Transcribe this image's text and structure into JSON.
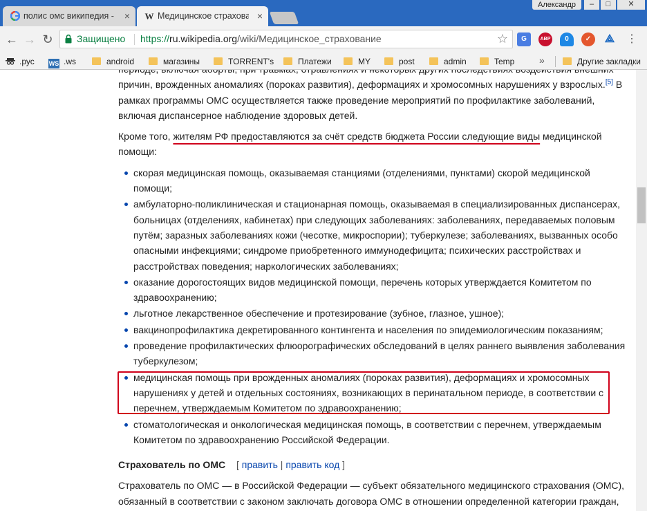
{
  "browser": {
    "tabs": [
      {
        "title": "полис омс википедия - По",
        "favicon": "google-icon",
        "active": false
      },
      {
        "title": "Медицинское страхование",
        "favicon": "wikipedia-icon",
        "active": true
      }
    ],
    "user": "Александр",
    "window_controls": {
      "minimize": "–",
      "maximize": "□",
      "close": "✕"
    },
    "nav": {
      "back": "←",
      "forward": "→",
      "reload": "↻"
    },
    "address": {
      "secure_label": "Защищено",
      "proto": "https://",
      "host": "ru.wikipedia.org",
      "path": "/wiki/Медицинское_страхование"
    },
    "extensions": [
      {
        "name": "translate-icon",
        "label": "G",
        "color": "#4a7de2"
      },
      {
        "name": "adblock-icon",
        "label": "ABP",
        "color": "#c8102e"
      },
      {
        "name": "ghostery-icon",
        "label": "0",
        "color": "#1e88e5"
      },
      {
        "name": "vpn-icon",
        "label": "✓",
        "color": "#e4572e"
      },
      {
        "name": "acrobat-icon",
        "label": "⟁",
        "color": "#1565c0"
      }
    ],
    "bookmarks": [
      {
        "label": ".рус",
        "icon": "spy-icon"
      },
      {
        "label": ".ws",
        "icon": "ws-icon"
      },
      {
        "label": "android",
        "icon": "folder-icon"
      },
      {
        "label": "магазины",
        "icon": "folder-icon"
      },
      {
        "label": "TORRENT's",
        "icon": "folder-icon"
      },
      {
        "label": "Платежи",
        "icon": "folder-icon"
      },
      {
        "label": "MY",
        "icon": "folder-icon"
      },
      {
        "label": "post",
        "icon": "folder-icon"
      },
      {
        "label": "admin",
        "icon": "folder-icon"
      },
      {
        "label": "Temp",
        "icon": "folder-icon"
      }
    ],
    "bookmarks_more": "»",
    "other_bookmarks": "Другие закладки"
  },
  "article": {
    "p1_text": "периоде, включая аборты; при травмах, отравлениях и некоторых других последствиях воздействия внешних причин, врожденных аномалиях (пороках развития), деформациях и хромосомных нарушениях у взрослых.",
    "p1_cite": "[5]",
    "p1_rest": " В рамках программы ОМС осуществляется также проведение мероприятий по профилактике заболеваний, включая диспансерное наблюдение здоровых детей.",
    "p2_start": "Кроме того, ",
    "p2_underlined": "жителям РФ предоставляются за счёт средств бюджета России следующие виды",
    "p2_end": " медицинской помощи:",
    "list": [
      "скорая медицинская помощь, оказываемая станциями (отделениями, пунктами) скорой медицинской помощи;",
      "амбулаторно-поликлиническая и стационарная помощь, оказываемая в специализированных диспансерах, больницах (отделениях, кабинетах) при следующих заболеваниях: заболеваниях, передаваемых половым путём; заразных заболеваниях кожи (чесотке, микроспории); туберкулезе; заболеваниях, вызванных особо опасными инфекциями; синдроме приобретенного иммунодефицита; психических расстройствах и расстройствах поведения; наркологических заболеваниях;",
      "оказание дорогостоящих видов медицинской помощи, перечень которых утверждается Комитетом по здравоохранению;",
      "льготное лекарственное обеспечение и протезирование (зубное, глазное, ушное);",
      "вакцинопрофилактика декретированного контингента и населения по эпидемиологическим показаниям;",
      "проведение профилактических флюорографических обследований в целях раннего выявления заболевания туберкулезом;",
      "медицинская помощь при врожденных аномалиях (пороках развития), деформациях и хромосомных нарушениях у детей и отдельных состояниях, возникающих в перинатальном периоде, в соответствии с перечнем, утверждаемым Комитетом по здравоохранению;",
      "стоматологическая и онкологическая медицинская помощь, в соответствии с перечнем, утверждаемым Комитетом по здравоохранению Российской Федерации."
    ],
    "section_heading": "Страхователь по ОМС",
    "edit_open": "[",
    "edit_link": "править",
    "edit_sep": "|",
    "edit_code_link": "править код",
    "edit_close": "]",
    "p3": "Страхователь по ОМС — в Российской Федерации — субъект обязательного медицинского страхования (ОМС), обязанный в соответствии с законом заключать договора ОМС в отношении определенной категории граждан, наделенный с этой целью определенными правами и обременный определенными обязанностями."
  },
  "annotation_colors": {
    "highlight": "#d0021b"
  }
}
